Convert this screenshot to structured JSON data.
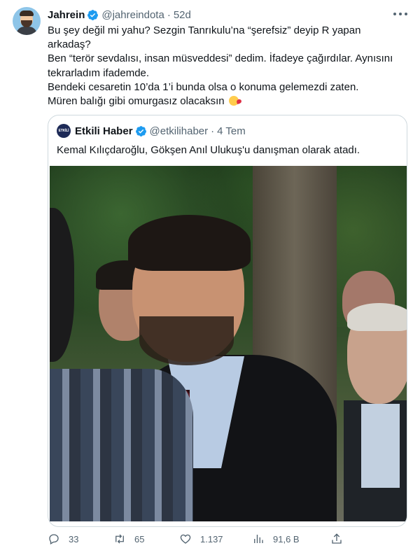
{
  "tweet": {
    "author_name": "Jahrein",
    "author_handle": "@jahreindota",
    "separator": "·",
    "time": "52d",
    "lines": [
      "Bu şey değil mi yahu? Sezgin Tanrıkulu’na “şerefsiz” deyip R yapan",
      "arkadaş?",
      "Ben “terör sevdalısı, insan müsveddesi” dedim. İfadeye çağırdılar. Aynısını",
      "tekrarladım ifademde.",
      "Bendeki cesaretin 10’da 1’i bunda olsa o konuma gelemezdi zaten.",
      "Müren balığı gibi omurgasız olacaksın"
    ],
    "emoji": "face-blowing-a-kiss"
  },
  "quote": {
    "avatar_text": "ETKİLİ HABER",
    "author_name": "Etkili Haber",
    "author_handle": "@etkilihaber",
    "separator": "·",
    "time": "4 Tem",
    "text": "Kemal Kılıçdaroğlu, Gökşen Anıl Ulukuş'u danışman olarak atadı.",
    "image": "photo-of-young-man-in-suit-outdoors"
  },
  "actions": {
    "replies": "33",
    "retweets": "65",
    "likes": "1.137",
    "views": "91,6 B"
  },
  "colors": {
    "verified": "#1d9bf0",
    "secondary_text": "#536471",
    "border": "#cfd9de"
  }
}
